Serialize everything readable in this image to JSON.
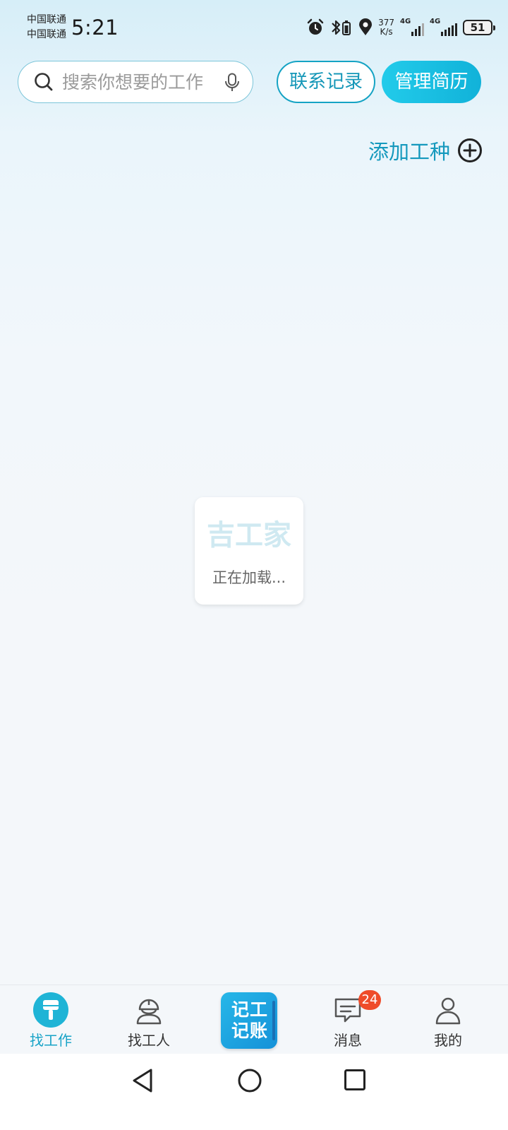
{
  "status_bar": {
    "carrier_1": "中国联通",
    "carrier_2": "中国联通",
    "time": "5:21",
    "net_speed_value": "377",
    "net_speed_unit": "K/s",
    "network_1": "4G",
    "network_2": "4G",
    "battery": "51"
  },
  "header": {
    "search_placeholder": "搜索你想要的工作",
    "contact_button": "联系记录",
    "resume_button": "管理简历",
    "add_trade_label": "添加工种"
  },
  "loading": {
    "logo_text": "吉工家",
    "message": "正在加载..."
  },
  "tab_bar": {
    "find_work": "找工作",
    "find_worker": "找工人",
    "ledger_line_1": "记工",
    "ledger_line_2": "记账",
    "messages": "消息",
    "messages_badge": "24",
    "mine": "我的",
    "active_tab": "找工作",
    "active_color": "#17a3c7"
  },
  "theme": {
    "accent": "#15a3c4",
    "badge_color": "#ef4c2a"
  }
}
